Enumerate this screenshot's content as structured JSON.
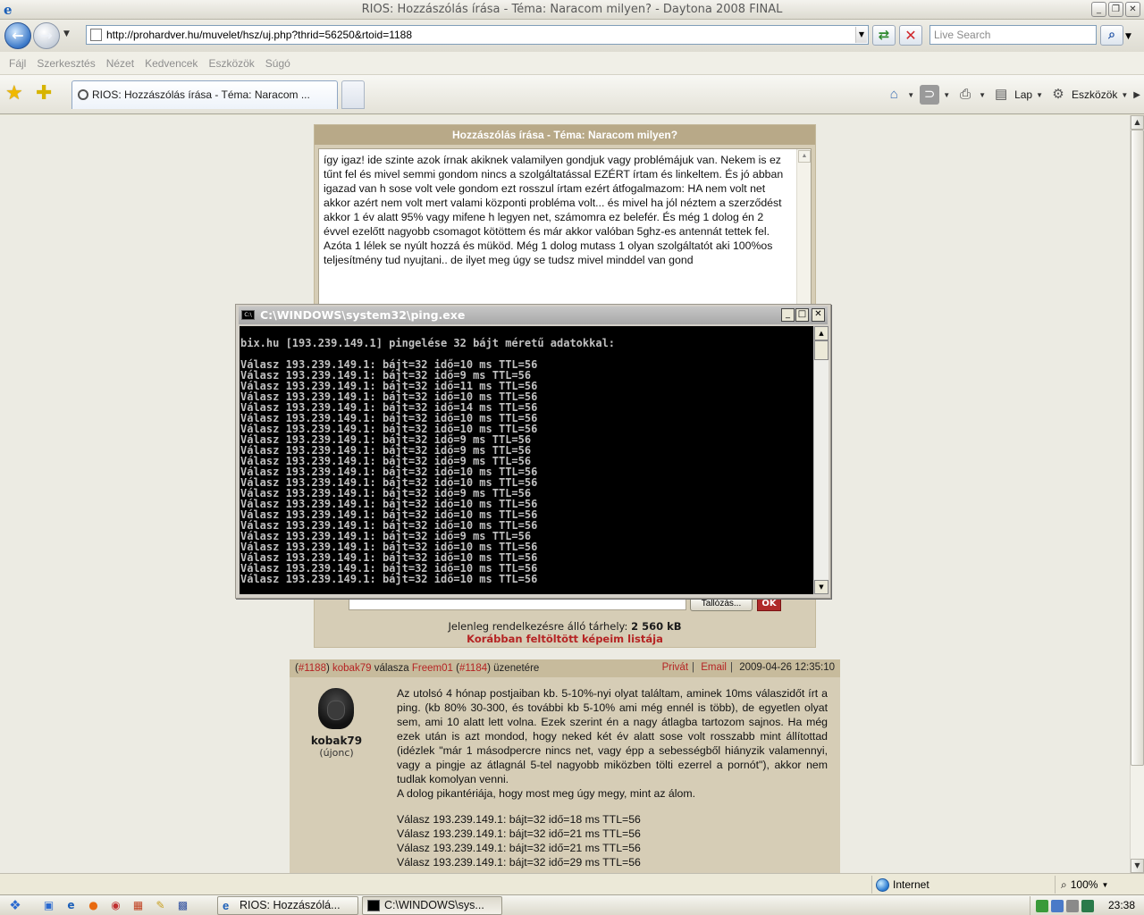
{
  "window": {
    "title": "RIOS: Hozzászólás írása - Téma: Naracom milyen? - Daytona 2008 FINAL"
  },
  "address": {
    "url": "http://prohardver.hu/muvelet/hsz/uj.php?thrid=56250&rtoid=1188",
    "search_placeholder": "Live Search"
  },
  "menu": [
    "Fájl",
    "Szerkesztés",
    "Nézet",
    "Kedvencek",
    "Eszközök",
    "Súgó"
  ],
  "tab": {
    "label": "RIOS: Hozzászólás írása - Téma: Naracom ..."
  },
  "commandbar": {
    "page_label": "Lap",
    "tools_label": "Eszközök"
  },
  "form": {
    "header": "Hozzászólás írása - Téma: Naracom milyen?",
    "textarea_value": "így igaz! ide szinte azok írnak akiknek valamilyen gondjuk vagy problémájuk van. Nekem is ez tűnt fel és mivel semmi gondom nincs a szolgáltatással EZÉRT írtam és linkeltem. És jó abban igazad van h sose volt vele gondom ezt rosszul írtam ezért átfogalmazom: HA nem volt net akkor azért nem volt mert valami központi probléma volt... és mivel ha jól néztem a szerződést akkor 1 év alatt 95% vagy mifene h legyen net, számomra ez belefér. És még 1 dolog én 2 évvel ezelőtt nagyobb csomagot kötöttem és már akkor valóban 5ghz-es antennát tettek fel. Azóta 1 lélek se nyúlt hozzá és müköd. Még 1 dolog mutass 1 olyan szolgáltatót aki 100%os teljesítmény tud nyujtani.. de ilyet meg úgy se tudsz mivel minddel van gond",
    "browse_label": "Tallózás...",
    "ok_label": "OK",
    "storage_text": "Jelenleg rendelkezésre álló tárhely:",
    "storage_value": "2 560 kB",
    "prev_images_link": "Korábban feltöltött képeim listája"
  },
  "post": {
    "id": "#1188",
    "author": "kobak79",
    "reply_word": "válasza",
    "reply_to_user": "Freem01",
    "reply_to_id": "#1184",
    "reply_suffix": "üzenetére",
    "private_label": "Privát",
    "email_label": "Email",
    "timestamp": "2009-04-26 12:35:10",
    "username": "kobak79",
    "rank": "(újonc)",
    "body_p1": "Az utolsó 4 hónap postjaiban kb. 5-10%-nyi olyat találtam, aminek 10ms válaszidőt írt a ping. (kb 80% 30-300, és további kb 5-10% ami még ennél is több), de egyetlen olyat sem, ami 10 alatt lett volna. Ezek szerint én a nagy átlagba tartozom sajnos. Ha még ezek után is azt mondod, hogy neked két év alatt sose volt rosszabb mint állítottad (idézlek \"már 1 másodpercre nincs net, vagy épp a sebességből hiányzik valamennyi, vagy a pingje az átlagnál 5-tel nagyobb miközben tölti ezerrel a pornót\"), akkor nem tudlak komolyan venni.",
    "body_p2": "A dolog pikantériája, hogy most meg úgy megy, mint az álom.",
    "ping_lines": [
      "Válasz 193.239.149.1: bájt=32 idő=18 ms TTL=56",
      "Válasz 193.239.149.1: bájt=32 idő=21 ms TTL=56",
      "Válasz 193.239.149.1: bájt=32 idő=21 ms TTL=56",
      "Válasz 193.239.149.1: bájt=32 idő=29 ms TTL=56"
    ]
  },
  "console": {
    "title": "C:\\WINDOWS\\system32\\ping.exe",
    "header_line": "bix.hu [193.239.149.1] pingelése 32 bájt méretű adatokkal:",
    "lines": [
      "Válasz 193.239.149.1: bájt=32 idő=10 ms TTL=56",
      "Válasz 193.239.149.1: bájt=32 idő=9 ms TTL=56",
      "Válasz 193.239.149.1: bájt=32 idő=11 ms TTL=56",
      "Válasz 193.239.149.1: bájt=32 idő=10 ms TTL=56",
      "Válasz 193.239.149.1: bájt=32 idő=14 ms TTL=56",
      "Válasz 193.239.149.1: bájt=32 idő=10 ms TTL=56",
      "Válasz 193.239.149.1: bájt=32 idő=10 ms TTL=56",
      "Válasz 193.239.149.1: bájt=32 idő=9 ms TTL=56",
      "Válasz 193.239.149.1: bájt=32 idő=9 ms TTL=56",
      "Válasz 193.239.149.1: bájt=32 idő=9 ms TTL=56",
      "Válasz 193.239.149.1: bájt=32 idő=10 ms TTL=56",
      "Válasz 193.239.149.1: bájt=32 idő=10 ms TTL=56",
      "Válasz 193.239.149.1: bájt=32 idő=9 ms TTL=56",
      "Válasz 193.239.149.1: bájt=32 idő=10 ms TTL=56",
      "Válasz 193.239.149.1: bájt=32 idő=10 ms TTL=56",
      "Válasz 193.239.149.1: bájt=32 idő=10 ms TTL=56",
      "Válasz 193.239.149.1: bájt=32 idő=9 ms TTL=56",
      "Válasz 193.239.149.1: bájt=32 idő=10 ms TTL=56",
      "Válasz 193.239.149.1: bájt=32 idő=10 ms TTL=56",
      "Válasz 193.239.149.1: bájt=32 idő=10 ms TTL=56",
      "Válasz 193.239.149.1: bájt=32 idő=10 ms TTL=56"
    ]
  },
  "statusbar": {
    "zone": "Internet",
    "zoom": "100%"
  },
  "taskbar": {
    "task1": "RIOS: Hozzászólá...",
    "task2": "C:\\WINDOWS\\sys...",
    "clock": "23:38"
  },
  "colors": {
    "panel_bg": "#d6cdb6",
    "header_bg": "#b8a988",
    "link_red": "#b52424"
  }
}
